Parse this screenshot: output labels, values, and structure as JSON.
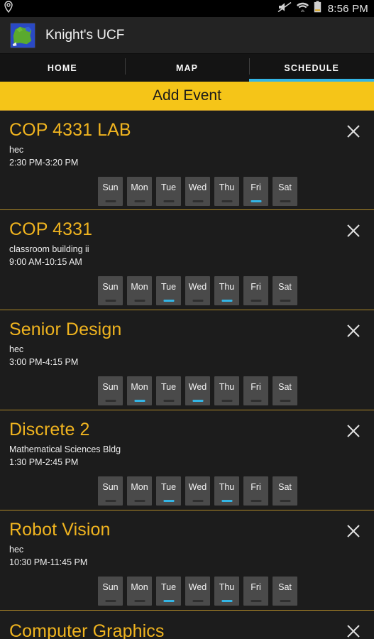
{
  "statusbar": {
    "location_icon": "location-pin-icon",
    "volume_icon": "volume-muted-icon",
    "wifi_icon": "wifi-icon",
    "battery_icon": "battery-icon",
    "time": "8:56 PM"
  },
  "appbar": {
    "logo_icon": "app-map-logo-icon",
    "title": "Knight's UCF"
  },
  "tabs": [
    {
      "label": "HOME",
      "active": false
    },
    {
      "label": "MAP",
      "active": false
    },
    {
      "label": "SCHEDULE",
      "active": true
    }
  ],
  "add_event": {
    "label": "Add Event"
  },
  "day_names": [
    "Sun",
    "Mon",
    "Tue",
    "Wed",
    "Thu",
    "Fri",
    "Sat"
  ],
  "close_icon": "close-icon",
  "colors": {
    "accent_gold": "#f0b41f",
    "add_event_bg": "#f5c518",
    "selected_day": "#33b5e5",
    "tab_indicator": "#33b5e5",
    "card_bg": "#1c1c1c",
    "divider": "#b08a28"
  },
  "events": [
    {
      "title": "COP 4331 LAB",
      "location": "hec",
      "time": "2:30 PM-3:20 PM",
      "selected_days": [
        "Fri"
      ]
    },
    {
      "title": "COP 4331",
      "location": "classroom building ii",
      "time": "9:00 AM-10:15 AM",
      "selected_days": [
        "Tue",
        "Thu"
      ]
    },
    {
      "title": "Senior Design",
      "location": "hec",
      "time": "3:00 PM-4:15 PM",
      "selected_days": [
        "Mon",
        "Wed"
      ]
    },
    {
      "title": "Discrete 2",
      "location": "Mathematical Sciences Bldg",
      "time": "1:30 PM-2:45 PM",
      "selected_days": [
        "Tue",
        "Thu"
      ]
    },
    {
      "title": "Robot Vision",
      "location": "hec",
      "time": "10:30 PM-11:45 PM",
      "selected_days": [
        "Tue",
        "Thu"
      ]
    },
    {
      "title": "Computer Graphics",
      "location": "",
      "time": "",
      "selected_days": [],
      "partial": true
    }
  ]
}
